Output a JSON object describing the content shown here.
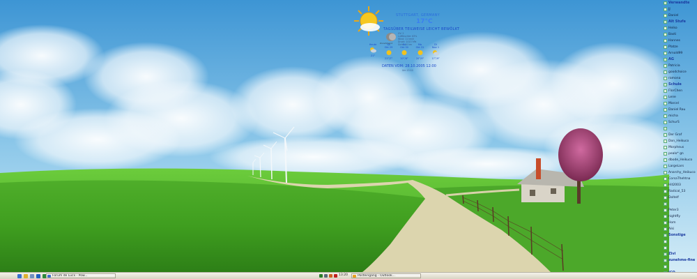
{
  "weather": {
    "location": "Stuttgart, Germany",
    "temperature": "17°C",
    "condition": "Tagsüber teilweise leicht bewölkt",
    "moon_label": "Zunehmend",
    "stats": [
      "UV: 2",
      "Luftfeuchte: 63%",
      "Wind: 11 km/h",
      "Druck: 1013 hPa",
      "Sicht: 10 km"
    ],
    "forecast": [
      {
        "day": "Heute",
        "date": "",
        "temp": "21°",
        "icon": "partly-cloudy-icon"
      },
      {
        "day": "Sa",
        "date": "Okt 29",
        "temp": "21°/7°",
        "icon": "sunny-icon"
      },
      {
        "day": "So",
        "date": "Okt 30",
        "temp": "20°/8°",
        "icon": "sunny-icon"
      },
      {
        "day": "Mo",
        "date": "Okt 31",
        "temp": "20°/9°",
        "icon": "sunny-icon"
      },
      {
        "day": "Di",
        "date": "Nov 1",
        "temp": "17°/9°",
        "icon": "partly-cloudy-icon"
      }
    ],
    "updated": "Daten vom: 28.10.2005 12:00",
    "updated_small": "Um 13:10"
  },
  "contacts": [
    {
      "type": "group",
      "label": "Verwandte"
    },
    {
      "type": "item",
      "label": "JJ"
    },
    {
      "type": "item",
      "label": "Daniel"
    },
    {
      "type": "group",
      "label": "Alt Stufe"
    },
    {
      "type": "item",
      "label": "Heiko"
    },
    {
      "type": "item",
      "label": "Basti"
    },
    {
      "type": "item",
      "label": "Hannes"
    },
    {
      "type": "item",
      "label": "Platze"
    },
    {
      "type": "item",
      "label": "Arnold99"
    },
    {
      "type": "group",
      "label": "AG"
    },
    {
      "type": "item",
      "label": "Patricia"
    },
    {
      "type": "item",
      "label": "goodchoice"
    },
    {
      "type": "item",
      "label": "ramona"
    },
    {
      "type": "group",
      "label": "Schule"
    },
    {
      "type": "item",
      "label": "FlorChen"
    },
    {
      "type": "item",
      "label": "Lene"
    },
    {
      "type": "item",
      "label": "Marcel"
    },
    {
      "type": "item",
      "label": "Daniel Rau"
    },
    {
      "type": "item",
      "label": "micha"
    },
    {
      "type": "item",
      "label": "SchurS"
    },
    {
      "type": "group",
      "label": ""
    },
    {
      "type": "item",
      "label": "Der Graf"
    },
    {
      "type": "item",
      "label": "Don_Heikuco"
    },
    {
      "type": "item",
      "label": "Morpheus"
    },
    {
      "type": "item",
      "label": "pealo* gn"
    },
    {
      "type": "item",
      "label": "dbode_Heikuco"
    },
    {
      "type": "item",
      "label": "LargeLars"
    },
    {
      "type": "item",
      "label": "Anarchy_Heikuco"
    },
    {
      "type": "item",
      "label": "CorsaThehtna"
    },
    {
      "type": "item",
      "label": "Hit2003"
    },
    {
      "type": "item",
      "label": "Radical_53"
    },
    {
      "type": "item",
      "label": "Doltelf"
    },
    {
      "type": "group",
      "label": ""
    },
    {
      "type": "item",
      "label": "Peter3"
    },
    {
      "type": "item",
      "label": "nightfly"
    },
    {
      "type": "item",
      "label": "Hom"
    },
    {
      "type": "item",
      "label": "Aiki"
    },
    {
      "type": "group",
      "label": "Sonstige"
    },
    {
      "type": "item",
      "label": ""
    },
    {
      "type": "item",
      "label": ""
    },
    {
      "type": "group",
      "label": "Zivi"
    },
    {
      "type": "group",
      "label": "zunehme-fine"
    },
    {
      "type": "item",
      "label": ""
    },
    {
      "type": "group",
      "label": "ICQ"
    }
  ],
  "taskbar": {
    "quicklaunch": [
      {
        "name": "show-desktop-icon",
        "color": "#3a6fd0"
      },
      {
        "name": "explorer-icon",
        "color": "#e0b030"
      },
      {
        "name": "mail-icon",
        "color": "#7090c0"
      },
      {
        "name": "browser-icon",
        "color": "#2060c0"
      },
      {
        "name": "media-icon",
        "color": "#2d8a3a"
      }
    ],
    "buttons": [
      {
        "label": "Forum de Lucx - Pow...",
        "icon_color": "#3d6dcc"
      },
      {
        "label": "Posteingang - Outlook...",
        "icon_color": "#e8a020"
      }
    ],
    "tray_icons": [
      {
        "name": "network-icon",
        "color": "#2a7d2a"
      },
      {
        "name": "volume-icon",
        "color": "#5a6a7a"
      },
      {
        "name": "messenger-icon",
        "color": "#d06020"
      },
      {
        "name": "antivirus-icon",
        "color": "#c02020"
      }
    ],
    "clock": "13:20"
  },
  "colors": {
    "sky_top": "#3d95d4",
    "sky_bottom": "#c8e6f5",
    "grass_light": "#6bc43c",
    "grass_dark": "#2f8f1c",
    "path": "#ded8b4",
    "group_header": "#1a3aa0"
  }
}
